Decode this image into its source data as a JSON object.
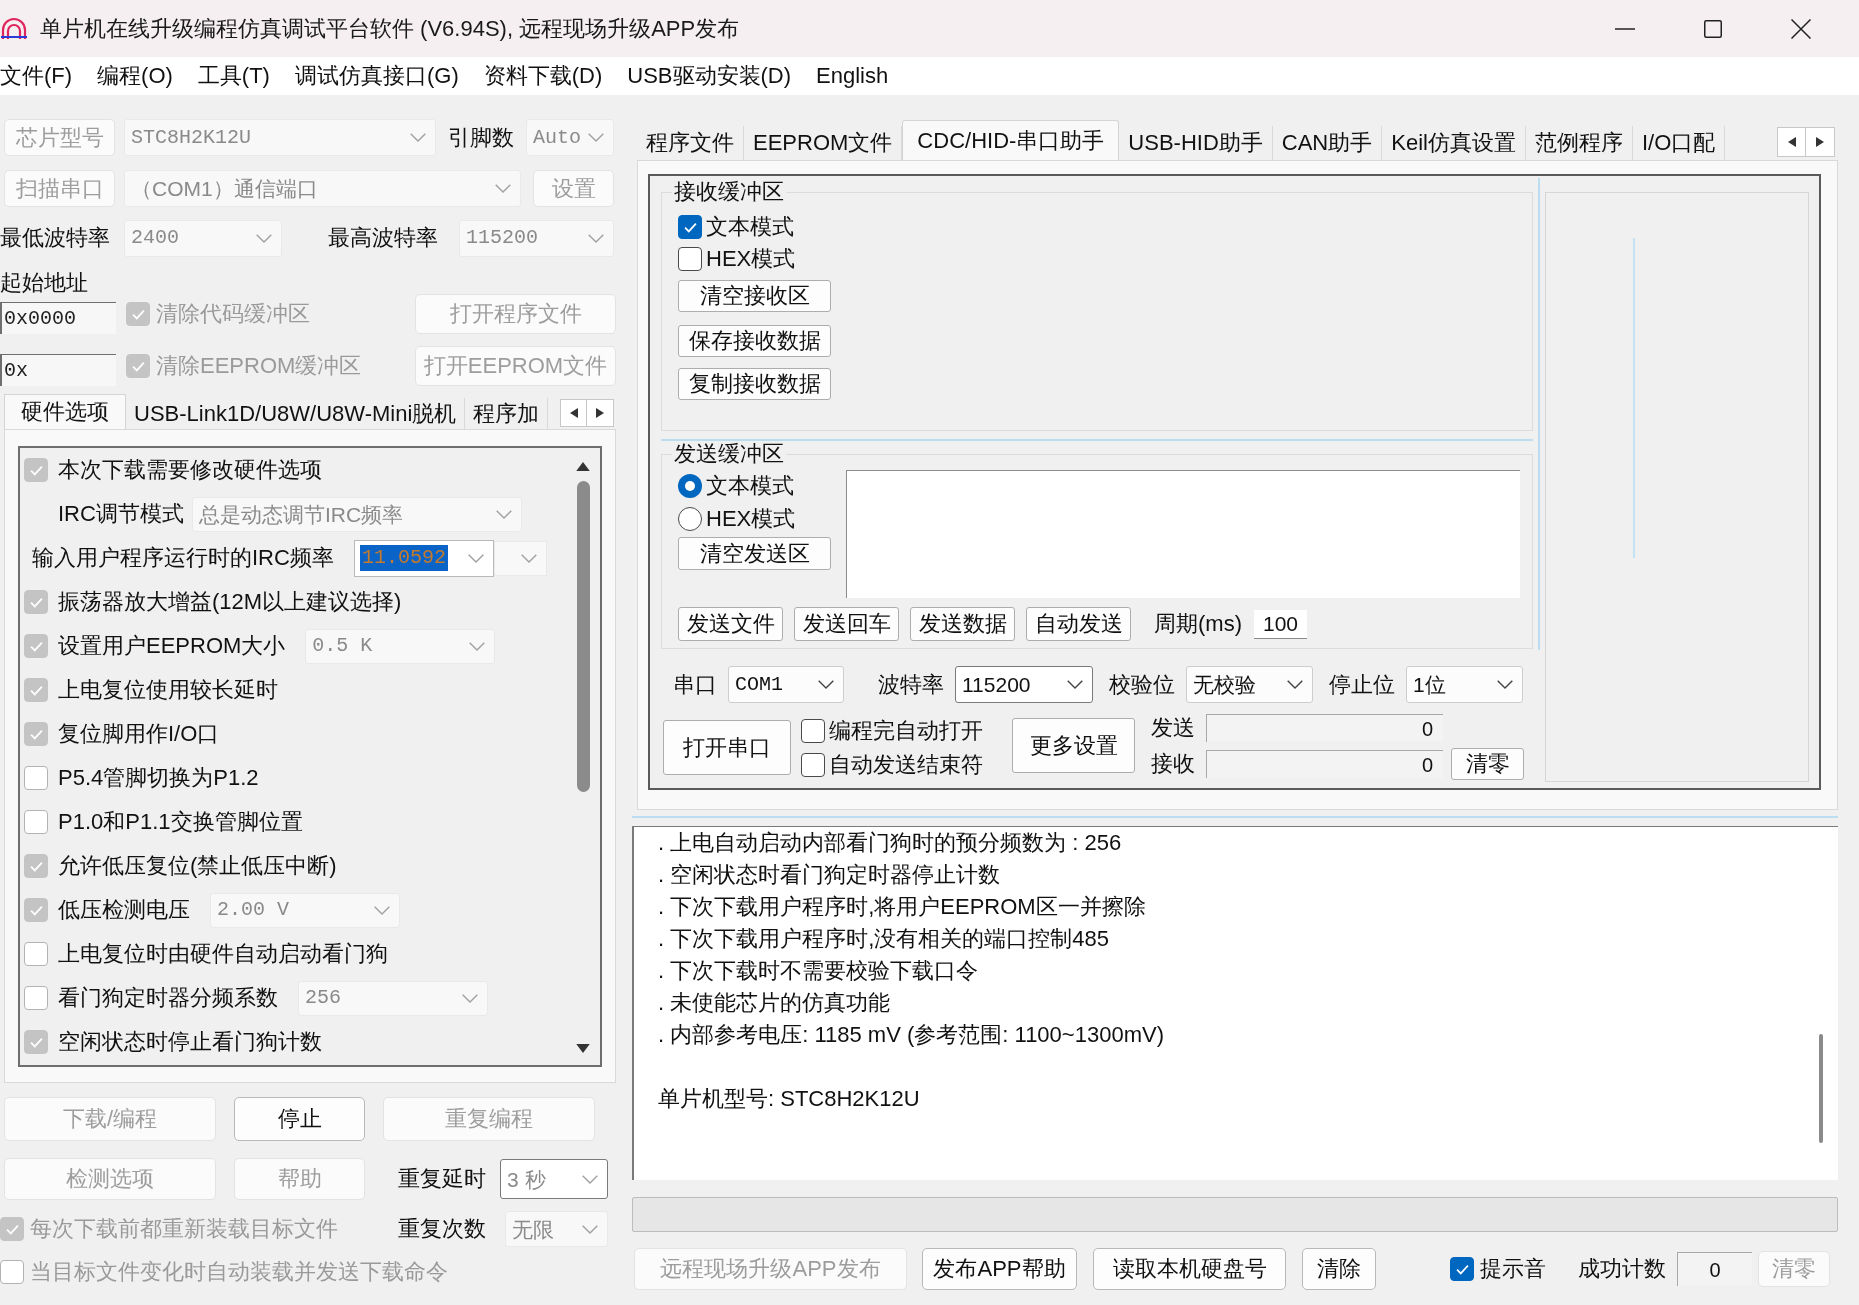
{
  "window": {
    "title": "单片机在线升级编程仿真调试平台软件 (V6.94S), 远程现场升级APP发布"
  },
  "menu": [
    "文件(F)",
    "编程(O)",
    "工具(T)",
    "调试仿真接口(G)",
    "资料下载(D)",
    "USB驱动安装(D)",
    "English"
  ],
  "chip": {
    "button": {
      "label": "芯片型号",
      "disabled": true
    },
    "combo": {
      "value": "STC8H2K12U",
      "disabled": true
    },
    "pins_label": "引脚数",
    "pins_combo": {
      "value": "Auto",
      "disabled": true
    }
  },
  "port": {
    "button": {
      "label": "扫描串口",
      "disabled": true
    },
    "combo": {
      "value": "（COM1）通信端口",
      "disabled": true
    },
    "settings_button": {
      "label": "设置",
      "disabled": true
    }
  },
  "baud": {
    "min_label": "最低波特率",
    "min_combo": {
      "value": "2400",
      "disabled": true
    },
    "max_label": "最高波特率",
    "max_combo": {
      "value": "115200",
      "disabled": true
    }
  },
  "start_address": {
    "label": "起始地址",
    "rows": [
      {
        "value": "0x0000",
        "option": "清除代码缓冲区",
        "checked": true,
        "disabled": true,
        "button": {
          "label": "打开程序文件",
          "disabled": true
        }
      },
      {
        "value": "0x",
        "option": "清除EEPROM缓冲区",
        "checked": true,
        "disabled": true,
        "button": {
          "label": "打开EEPROM文件",
          "disabled": true
        }
      }
    ]
  },
  "left_tabs": [
    {
      "label": "硬件选项",
      "selected": true
    },
    {
      "label": "USB-Link1D/U8W/U8W-Mini脱机",
      "selected": false
    },
    {
      "label": "程序加",
      "selected": false
    }
  ],
  "hardware_options": {
    "disabled": true,
    "items": [
      {
        "kind": "check",
        "label": "本次下载需要修改硬件选项",
        "checked": true
      },
      {
        "kind": "combo",
        "label": "IRC调节模式",
        "value": "总是动态调节IRC频率"
      },
      {
        "kind": "edit",
        "label": "输入用户程序运行时的IRC频率",
        "value": "11.0592",
        "highlighted": true
      },
      {
        "kind": "check",
        "label": "振荡器放大增益(12M以上建议选择)",
        "checked": true
      },
      {
        "kind": "check_combo",
        "label": "设置用户EEPROM大小",
        "checked": true,
        "value": "0.5 K"
      },
      {
        "kind": "check",
        "label": "上电复位使用较长延时",
        "checked": true
      },
      {
        "kind": "check",
        "label": "复位脚用作I/O口",
        "checked": true
      },
      {
        "kind": "check",
        "label": "P5.4管脚切换为P1.2",
        "checked": false
      },
      {
        "kind": "check",
        "label": "P1.0和P1.1交换管脚位置",
        "checked": false
      },
      {
        "kind": "check",
        "label": "允许低压复位(禁止低压中断)",
        "checked": true
      },
      {
        "kind": "check_combo",
        "label": "低压检测电压",
        "checked": true,
        "value": "2.00 V"
      },
      {
        "kind": "check",
        "label": "上电复位时由硬件自动启动看门狗",
        "checked": false
      },
      {
        "kind": "check_combo",
        "label": "看门狗定时器分频系数",
        "checked": false,
        "value": "256"
      },
      {
        "kind": "check",
        "label": "空闲状态时停止看门狗计数",
        "checked": true
      }
    ]
  },
  "program_buttons": [
    {
      "label": "下载/编程",
      "disabled": true
    },
    {
      "label": "停止",
      "disabled": false
    },
    {
      "label": "重复编程",
      "disabled": true
    },
    {
      "label": "检测选项",
      "disabled": true
    },
    {
      "label": "帮助",
      "disabled": true
    }
  ],
  "repeat": {
    "delay_label": "重复延时",
    "delay_combo": {
      "value": "3 秒",
      "disabled": true,
      "focused": true
    },
    "count_label": "重复次数",
    "count_combo": {
      "value": "无限",
      "disabled": true,
      "focused": false
    }
  },
  "reload_options": [
    {
      "label": "每次下载前都重新装载目标文件",
      "checked": true,
      "disabled": true
    },
    {
      "label": "当目标文件变化时自动装载并发送下载命令",
      "checked": false,
      "disabled": true
    }
  ],
  "right_tabs": [
    {
      "label": "程序文件",
      "selected": false
    },
    {
      "label": "EEPROM文件",
      "selected": false
    },
    {
      "label": "CDC/HID-串口助手",
      "selected": true
    },
    {
      "label": "USB-HID助手",
      "selected": false
    },
    {
      "label": "CAN助手",
      "selected": false
    },
    {
      "label": "Keil仿真设置",
      "selected": false
    },
    {
      "label": "范例程序",
      "selected": false
    },
    {
      "label": "I/O口配",
      "selected": false
    }
  ],
  "receive_buffer": {
    "title": "接收缓冲区",
    "modes": [
      {
        "label": "文本模式",
        "checked": true
      },
      {
        "label": "HEX模式",
        "checked": false
      }
    ],
    "buttons": [
      "清空接收区",
      "保存接收数据",
      "复制接收数据"
    ]
  },
  "send_buffer": {
    "title": "发送缓冲区",
    "modes": [
      {
        "label": "文本模式",
        "selected": true
      },
      {
        "label": "HEX模式",
        "selected": false
      }
    ],
    "clear_button": "清空发送区",
    "buttons": [
      "发送文件",
      "发送回车",
      "发送数据",
      "自动发送"
    ],
    "period_label": "周期(ms)",
    "period_value": "100"
  },
  "serial": {
    "fields": [
      {
        "label": "串口",
        "value": "COM1",
        "focused": false
      },
      {
        "label": "波特率",
        "value": "115200",
        "focused": true
      },
      {
        "label": "校验位",
        "value": "无校验",
        "focused": false
      },
      {
        "label": "停止位",
        "value": "1位",
        "focused": false
      }
    ],
    "open_button": "打开串口",
    "options": [
      {
        "label": "编程完自动打开",
        "checked": false
      },
      {
        "label": "自动发送结束符",
        "checked": false
      }
    ],
    "more_button": "更多设置",
    "counters": [
      {
        "label": "发送",
        "value": "0"
      },
      {
        "label": "接收",
        "value": "0"
      }
    ],
    "reset_button": "清零"
  },
  "log": {
    "lines": [
      {
        "kind": "item",
        "text": ". 上电自动启动内部看门狗时的预分频数为 : 256"
      },
      {
        "kind": "item",
        "text": ". 空闲状态时看门狗定时器停止计数"
      },
      {
        "kind": "item",
        "text": ". 下次下载用户程序时,将用户EEPROM区一并擦除"
      },
      {
        "kind": "item",
        "text": ". 下次下载用户程序时,没有相关的端口控制485"
      },
      {
        "kind": "item",
        "text": ". 下次下载时不需要校验下载口令"
      },
      {
        "kind": "item",
        "text": ". 未使能芯片的仿真功能"
      },
      {
        "kind": "item",
        "text": ". 内部参考电压: 1185 mV (参考范围: 1100~1300mV)"
      },
      {
        "kind": "summary",
        "text": "单片机型号: STC8H2K12U"
      }
    ]
  },
  "progress": {
    "level": 0
  },
  "bottom_bar": {
    "buttons": [
      {
        "label": "远程现场升级APP发布",
        "disabled": true
      },
      {
        "label": "发布APP帮助",
        "disabled": false
      },
      {
        "label": "读取本机硬盘号",
        "disabled": false
      },
      {
        "label": "清除",
        "disabled": false
      }
    ],
    "beep": {
      "label": "提示音",
      "checked": true
    },
    "count_label": "成功计数",
    "count_value": "0",
    "reset_button": {
      "label": "清零",
      "disabled": true
    }
  }
}
